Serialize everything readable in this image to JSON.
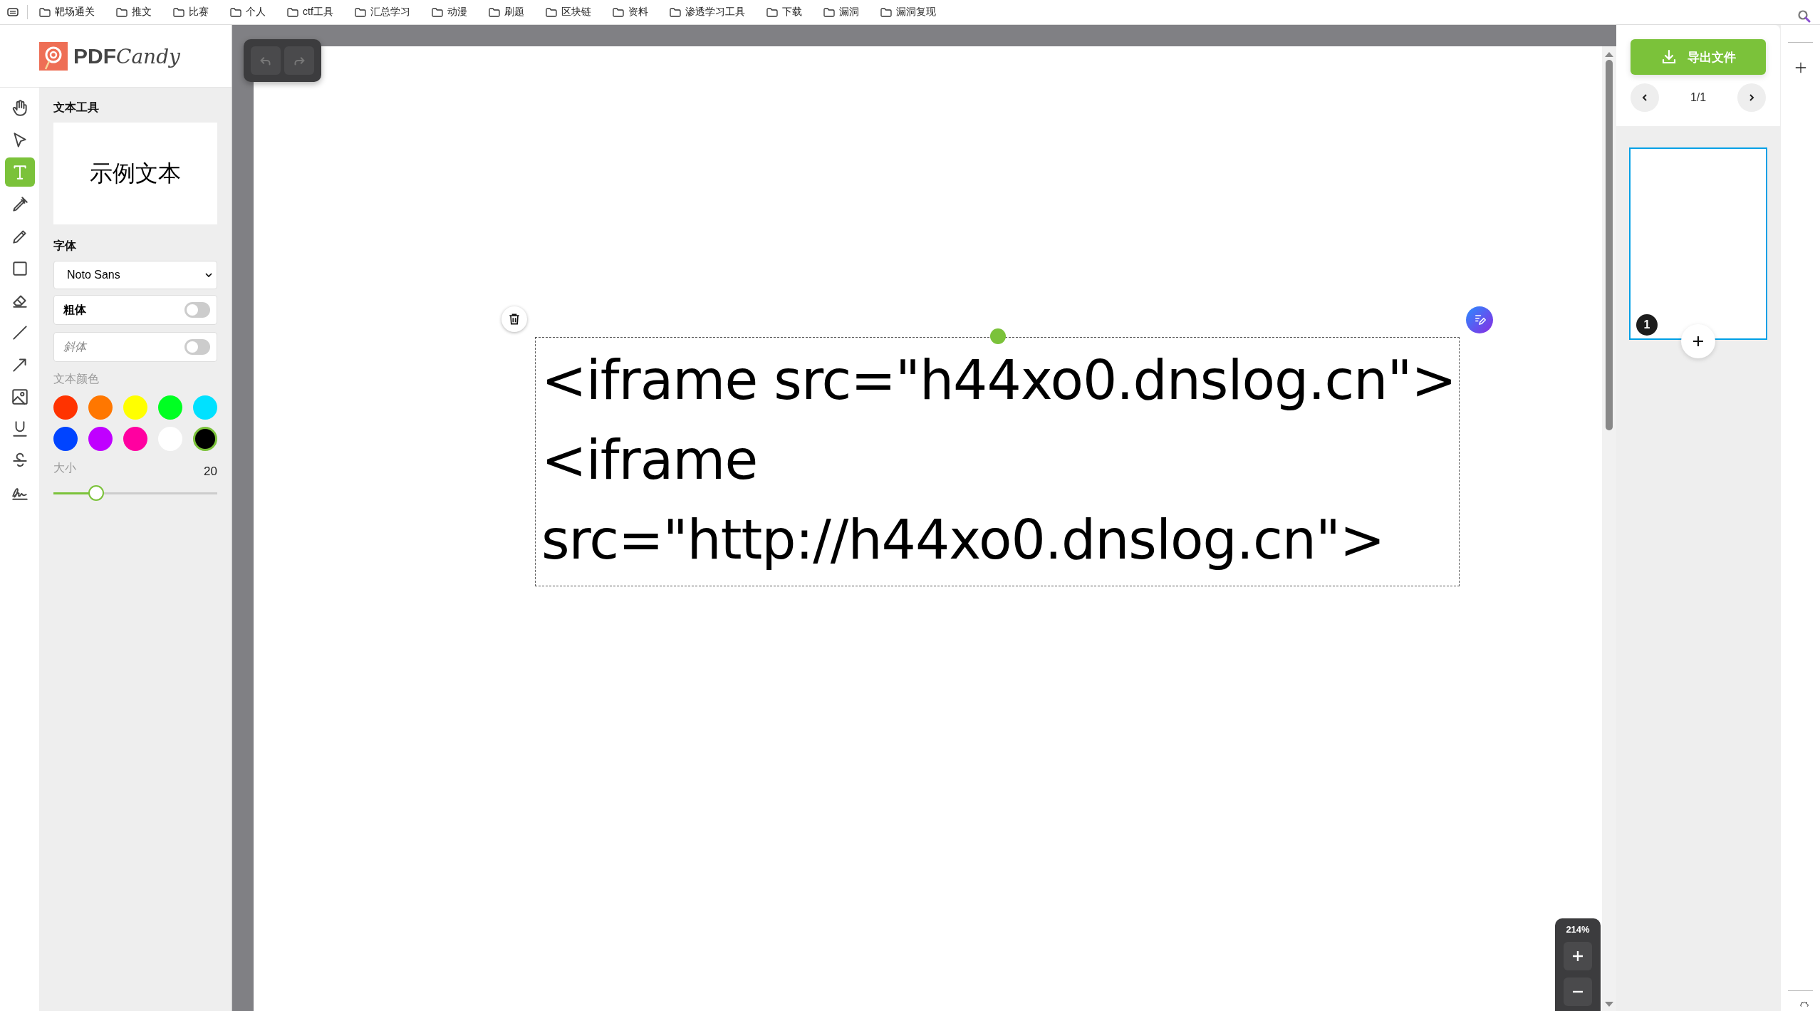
{
  "bookmarks": [
    {
      "label": "靶场通关"
    },
    {
      "label": "推文"
    },
    {
      "label": "比赛"
    },
    {
      "label": "个人"
    },
    {
      "label": "ctf工具"
    },
    {
      "label": "汇总学习"
    },
    {
      "label": "动漫"
    },
    {
      "label": "刷题"
    },
    {
      "label": "区块链"
    },
    {
      "label": "资料"
    },
    {
      "label": "渗透学习工具"
    },
    {
      "label": "下载"
    },
    {
      "label": "漏洞"
    },
    {
      "label": "漏洞复现"
    }
  ],
  "logo": {
    "brand": "PDF",
    "script": "Candy"
  },
  "tools": [
    {
      "kind": "hand",
      "selected": false
    },
    {
      "kind": "pointer",
      "selected": false
    },
    {
      "kind": "text",
      "selected": true
    },
    {
      "kind": "marker",
      "selected": false
    },
    {
      "kind": "pencil",
      "selected": false
    },
    {
      "kind": "rectangle",
      "selected": false
    },
    {
      "kind": "eraser",
      "selected": false
    },
    {
      "kind": "line",
      "selected": false
    },
    {
      "kind": "arrow",
      "selected": false
    },
    {
      "kind": "image",
      "selected": false
    },
    {
      "kind": "underline",
      "selected": false
    },
    {
      "kind": "strike",
      "selected": false
    },
    {
      "kind": "signature",
      "selected": false
    }
  ],
  "text_panel": {
    "title": "文本工具",
    "preview": "示例文本",
    "font_label": "字体",
    "font": "Noto Sans",
    "toggles": [
      {
        "label": "粗体",
        "on": false,
        "kind": "bold"
      },
      {
        "label": "斜体",
        "on": false,
        "kind": "italic"
      }
    ],
    "color_label": "文本颜色",
    "colors": [
      {
        "color": "#ff3300",
        "selected": false
      },
      {
        "color": "#ff7700",
        "selected": false
      },
      {
        "color": "#ffff00",
        "selected": false
      },
      {
        "color": "#00ff22",
        "selected": false
      },
      {
        "color": "#00e1ff",
        "selected": false
      },
      {
        "color": "#0044ff",
        "selected": false
      },
      {
        "color": "#c000ff",
        "selected": false
      },
      {
        "color": "#ff00a0",
        "selected": false
      },
      {
        "color": "#ffffff",
        "selected": false
      },
      {
        "color": "#000000",
        "selected": true
      }
    ],
    "size_label": "大小",
    "size_value": "20",
    "size_slider": {
      "level": 0.26
    }
  },
  "text_box": {
    "lines": [
      "<iframe src=\"h44xo0.dnslog.cn\">",
      "<iframe",
      "src=\"http://h44xo0.dnslog.cn\">"
    ]
  },
  "zoom": {
    "value": "214%"
  },
  "right_panel": {
    "export": "导出文件",
    "page": "1/1",
    "thumbnails": [
      {
        "number": "1",
        "selected": true
      }
    ]
  }
}
